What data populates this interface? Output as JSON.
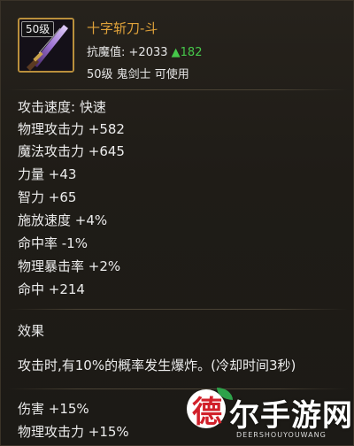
{
  "item": {
    "name": "十字斩刀-斗",
    "level_badge": "50级",
    "icon": "katana-icon",
    "resist_label": "抗魔值:",
    "resist_value": "+2033",
    "resist_bonus": "▲182",
    "requirement": "50级 鬼剑士 可使用"
  },
  "stats": [
    "攻击速度: 快速",
    "物理攻击力 +582",
    "魔法攻击力 +645",
    "力量 +43",
    "智力 +65",
    "施放速度 +4%",
    "命中率 -1%",
    "物理暴击率 +2%",
    "命中 +214"
  ],
  "effect": {
    "title": "效果",
    "description": "攻击时,有10%的概率发生爆炸。(冷却时间3秒)"
  },
  "bottom_stats": [
    "伤害 +15%",
    "物理攻击力 +15%"
  ],
  "watermark": {
    "glyph": "德",
    "text": "尔手游网",
    "subtitle": "DEERSHOUYOUWANG"
  },
  "colors": {
    "item_name": "#e0a23a",
    "bonus_green": "#46c84a",
    "text": "#ececec",
    "icon_border": "#b98f3c"
  }
}
